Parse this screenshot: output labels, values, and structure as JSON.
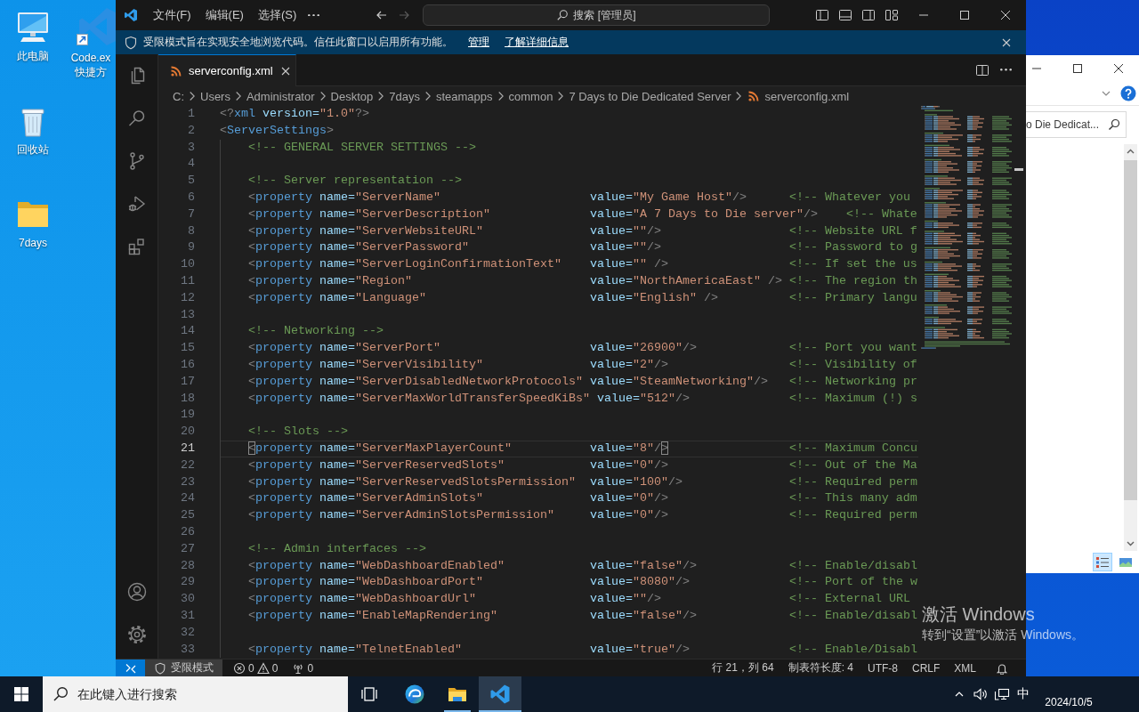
{
  "desktop": {
    "icons": [
      {
        "kind": "computer",
        "lines": [
          "此电脑"
        ]
      },
      {
        "kind": "recycle-bin",
        "lines": [
          "回收站"
        ]
      },
      {
        "kind": "folder",
        "lines": [
          "7days"
        ]
      },
      {
        "kind": "shortcut",
        "lines": [
          "Code.ex",
          "快捷方"
        ]
      }
    ]
  },
  "editor_window": {
    "menus": [
      "文件(F)",
      "编辑(E)",
      "选择(S)"
    ],
    "navigation": [
      {
        "kind": "back",
        "disabled": false
      },
      {
        "kind": "forward",
        "disabled": true
      }
    ],
    "command_center": "搜索 [管理员]",
    "banner": {
      "message": "受限模式旨在实现安全地浏览代码。信任此窗口以启用所有功能。",
      "links": [
        "管理",
        "了解详细信息"
      ]
    },
    "tabs": [
      {
        "label": "serverconfig.xml",
        "selected": true
      }
    ],
    "breadcrumbs": [
      {
        "kind": "folder",
        "label": "C:"
      },
      {
        "kind": "folder",
        "label": "Users"
      },
      {
        "kind": "folder",
        "label": "Administrator"
      },
      {
        "kind": "folder",
        "label": "Desktop"
      },
      {
        "kind": "folder",
        "label": "7days"
      },
      {
        "kind": "folder",
        "label": "steamapps"
      },
      {
        "kind": "folder",
        "label": "common"
      },
      {
        "kind": "folder",
        "label": "7 Days to Die Dedicated Server"
      },
      {
        "kind": "file",
        "label": "serverconfig.xml"
      }
    ],
    "lines": [
      {
        "number": "1",
        "current": false,
        "tokens": [
          {
            "kind": "punct",
            "text": "<?"
          },
          {
            "kind": "tag",
            "text": "xml"
          },
          {
            "kind": "attr",
            "text": " version="
          },
          {
            "kind": "string",
            "text": "\"1.0\""
          },
          {
            "kind": "punct",
            "text": "?>"
          }
        ]
      },
      {
        "number": "2",
        "current": false,
        "tokens": [
          {
            "kind": "punct",
            "text": "<"
          },
          {
            "kind": "tag",
            "text": "ServerSettings"
          },
          {
            "kind": "punct",
            "text": ">"
          }
        ],
        "children": [
          {
            "number": "3",
            "current": false,
            "tokens": [
              {
                "kind": "comment",
                "text": "<!-- GENERAL SERVER SETTINGS -->"
              }
            ]
          },
          {
            "number": "4",
            "current": false
          },
          {
            "number": "5",
            "current": false,
            "tokens": [
              {
                "kind": "comment",
                "text": "<!-- Server representation -->"
              }
            ]
          },
          {
            "number": "6",
            "current": false,
            "tokens": [
              {
                "kind": "punct",
                "text": "<"
              },
              {
                "kind": "tag",
                "text": "property"
              },
              {
                "kind": "attr",
                "text": " name="
              },
              {
                "kind": "string",
                "text": "\"ServerName\""
              },
              {
                "kind": "attr",
                "text": "                     value="
              },
              {
                "kind": "string",
                "text": "\"My Game Host\""
              },
              {
                "kind": "punct",
                "text": "/>      "
              },
              {
                "kind": "comment",
                "text": "<!-- Whatever you"
              }
            ]
          },
          {
            "number": "7",
            "current": false,
            "tokens": [
              {
                "kind": "punct",
                "text": "<"
              },
              {
                "kind": "tag",
                "text": "property"
              },
              {
                "kind": "attr",
                "text": " name="
              },
              {
                "kind": "string",
                "text": "\"ServerDescription\""
              },
              {
                "kind": "attr",
                "text": "              value="
              },
              {
                "kind": "string",
                "text": "\"A 7 Days to Die server\""
              },
              {
                "kind": "punct",
                "text": "/>    "
              },
              {
                "kind": "comment",
                "text": "<!-- Whate"
              }
            ]
          },
          {
            "number": "8",
            "current": false,
            "tokens": [
              {
                "kind": "punct",
                "text": "<"
              },
              {
                "kind": "tag",
                "text": "property"
              },
              {
                "kind": "attr",
                "text": " name="
              },
              {
                "kind": "string",
                "text": "\"ServerWebsiteURL\""
              },
              {
                "kind": "attr",
                "text": "               value="
              },
              {
                "kind": "string",
                "text": "\"\""
              },
              {
                "kind": "punct",
                "text": "/>                  "
              },
              {
                "kind": "comment",
                "text": "<!-- Website URL f"
              }
            ]
          },
          {
            "number": "9",
            "current": false,
            "tokens": [
              {
                "kind": "punct",
                "text": "<"
              },
              {
                "kind": "tag",
                "text": "property"
              },
              {
                "kind": "attr",
                "text": " name="
              },
              {
                "kind": "string",
                "text": "\"ServerPassword\""
              },
              {
                "kind": "attr",
                "text": "                 value="
              },
              {
                "kind": "string",
                "text": "\"\""
              },
              {
                "kind": "punct",
                "text": "/>                  "
              },
              {
                "kind": "comment",
                "text": "<!-- Password to g"
              }
            ]
          },
          {
            "number": "10",
            "current": false,
            "tokens": [
              {
                "kind": "punct",
                "text": "<"
              },
              {
                "kind": "tag",
                "text": "property"
              },
              {
                "kind": "attr",
                "text": " name="
              },
              {
                "kind": "string",
                "text": "\"ServerLoginConfirmationText\""
              },
              {
                "kind": "attr",
                "text": "    value="
              },
              {
                "kind": "string",
                "text": "\"\""
              },
              {
                "kind": "punct",
                "text": " />                 "
              },
              {
                "kind": "comment",
                "text": "<!-- If set the us"
              }
            ]
          },
          {
            "number": "11",
            "current": false,
            "tokens": [
              {
                "kind": "punct",
                "text": "<"
              },
              {
                "kind": "tag",
                "text": "property"
              },
              {
                "kind": "attr",
                "text": " name="
              },
              {
                "kind": "string",
                "text": "\"Region\""
              },
              {
                "kind": "attr",
                "text": "                         value="
              },
              {
                "kind": "string",
                "text": "\"NorthAmericaEast\""
              },
              {
                "kind": "punct",
                "text": " /> "
              },
              {
                "kind": "comment",
                "text": "<!-- The region th"
              }
            ]
          },
          {
            "number": "12",
            "current": false,
            "tokens": [
              {
                "kind": "punct",
                "text": "<"
              },
              {
                "kind": "tag",
                "text": "property"
              },
              {
                "kind": "attr",
                "text": " name="
              },
              {
                "kind": "string",
                "text": "\"Language\""
              },
              {
                "kind": "attr",
                "text": "                       value="
              },
              {
                "kind": "string",
                "text": "\"English\""
              },
              {
                "kind": "punct",
                "text": " />          "
              },
              {
                "kind": "comment",
                "text": "<!-- Primary langu"
              }
            ]
          },
          {
            "number": "13",
            "current": false
          },
          {
            "number": "14",
            "current": false,
            "tokens": [
              {
                "kind": "comment",
                "text": "<!-- Networking -->"
              }
            ]
          },
          {
            "number": "15",
            "current": false,
            "tokens": [
              {
                "kind": "punct",
                "text": "<"
              },
              {
                "kind": "tag",
                "text": "property"
              },
              {
                "kind": "attr",
                "text": " name="
              },
              {
                "kind": "string",
                "text": "\"ServerPort\""
              },
              {
                "kind": "attr",
                "text": "                     value="
              },
              {
                "kind": "string",
                "text": "\"26900\""
              },
              {
                "kind": "punct",
                "text": "/>             "
              },
              {
                "kind": "comment",
                "text": "<!-- Port you want"
              }
            ]
          },
          {
            "number": "16",
            "current": false,
            "tokens": [
              {
                "kind": "punct",
                "text": "<"
              },
              {
                "kind": "tag",
                "text": "property"
              },
              {
                "kind": "attr",
                "text": " name="
              },
              {
                "kind": "string",
                "text": "\"ServerVisibility\""
              },
              {
                "kind": "attr",
                "text": "               value="
              },
              {
                "kind": "string",
                "text": "\"2\""
              },
              {
                "kind": "punct",
                "text": "/>                 "
              },
              {
                "kind": "comment",
                "text": "<!-- Visibility of"
              }
            ]
          },
          {
            "number": "17",
            "current": false,
            "tokens": [
              {
                "kind": "punct",
                "text": "<"
              },
              {
                "kind": "tag",
                "text": "property"
              },
              {
                "kind": "attr",
                "text": " name="
              },
              {
                "kind": "string",
                "text": "\"ServerDisabledNetworkProtocols\""
              },
              {
                "kind": "attr",
                "text": " value="
              },
              {
                "kind": "string",
                "text": "\"SteamNetworking\""
              },
              {
                "kind": "punct",
                "text": "/>   "
              },
              {
                "kind": "comment",
                "text": "<!-- Networking pr"
              }
            ]
          },
          {
            "number": "18",
            "current": false,
            "tokens": [
              {
                "kind": "punct",
                "text": "<"
              },
              {
                "kind": "tag",
                "text": "property"
              },
              {
                "kind": "attr",
                "text": " name="
              },
              {
                "kind": "string",
                "text": "\"ServerMaxWorldTransferSpeedKiBs\""
              },
              {
                "kind": "attr",
                "text": " value="
              },
              {
                "kind": "string",
                "text": "\"512\""
              },
              {
                "kind": "punct",
                "text": "/>              "
              },
              {
                "kind": "comment",
                "text": "<!-- Maximum (!) s"
              }
            ]
          },
          {
            "number": "19",
            "current": false
          },
          {
            "number": "20",
            "current": false,
            "tokens": [
              {
                "kind": "comment",
                "text": "<!-- Slots -->"
              }
            ]
          },
          {
            "number": "21",
            "current": true,
            "tokens": [
              {
                "kind": "match",
                "text": "<"
              },
              {
                "kind": "tag",
                "text": "property"
              },
              {
                "kind": "attr",
                "text": " name="
              },
              {
                "kind": "string",
                "text": "\"ServerMaxPlayerCount\""
              },
              {
                "kind": "attr",
                "text": "           value="
              },
              {
                "kind": "string",
                "text": "\"8\""
              },
              {
                "kind": "punct",
                "text": "/"
              },
              {
                "kind": "match",
                "text": ">"
              },
              {
                "kind": "comment",
                "text": "                 <!-- Maximum Concu"
              }
            ]
          },
          {
            "number": "22",
            "current": false,
            "tokens": [
              {
                "kind": "punct",
                "text": "<"
              },
              {
                "kind": "tag",
                "text": "property"
              },
              {
                "kind": "attr",
                "text": " name="
              },
              {
                "kind": "string",
                "text": "\"ServerReservedSlots\""
              },
              {
                "kind": "attr",
                "text": "            value="
              },
              {
                "kind": "string",
                "text": "\"0\""
              },
              {
                "kind": "punct",
                "text": "/>                 "
              },
              {
                "kind": "comment",
                "text": "<!-- Out of the Ma"
              }
            ]
          },
          {
            "number": "23",
            "current": false,
            "tokens": [
              {
                "kind": "punct",
                "text": "<"
              },
              {
                "kind": "tag",
                "text": "property"
              },
              {
                "kind": "attr",
                "text": " name="
              },
              {
                "kind": "string",
                "text": "\"ServerReservedSlotsPermission\""
              },
              {
                "kind": "attr",
                "text": "  value="
              },
              {
                "kind": "string",
                "text": "\"100\""
              },
              {
                "kind": "punct",
                "text": "/>               "
              },
              {
                "kind": "comment",
                "text": "<!-- Required perm"
              }
            ]
          },
          {
            "number": "24",
            "current": false,
            "tokens": [
              {
                "kind": "punct",
                "text": "<"
              },
              {
                "kind": "tag",
                "text": "property"
              },
              {
                "kind": "attr",
                "text": " name="
              },
              {
                "kind": "string",
                "text": "\"ServerAdminSlots\""
              },
              {
                "kind": "attr",
                "text": "               value="
              },
              {
                "kind": "string",
                "text": "\"0\""
              },
              {
                "kind": "punct",
                "text": "/>                 "
              },
              {
                "kind": "comment",
                "text": "<!-- This many adm"
              }
            ]
          },
          {
            "number": "25",
            "current": false,
            "tokens": [
              {
                "kind": "punct",
                "text": "<"
              },
              {
                "kind": "tag",
                "text": "property"
              },
              {
                "kind": "attr",
                "text": " name="
              },
              {
                "kind": "string",
                "text": "\"ServerAdminSlotsPermission\""
              },
              {
                "kind": "attr",
                "text": "     value="
              },
              {
                "kind": "string",
                "text": "\"0\""
              },
              {
                "kind": "punct",
                "text": "/>                 "
              },
              {
                "kind": "comment",
                "text": "<!-- Required perm"
              }
            ]
          },
          {
            "number": "26",
            "current": false
          },
          {
            "number": "27",
            "current": false,
            "tokens": [
              {
                "kind": "comment",
                "text": "<!-- Admin interfaces -->"
              }
            ]
          },
          {
            "number": "28",
            "current": false,
            "tokens": [
              {
                "kind": "punct",
                "text": "<"
              },
              {
                "kind": "tag",
                "text": "property"
              },
              {
                "kind": "attr",
                "text": " name="
              },
              {
                "kind": "string",
                "text": "\"WebDashboardEnabled\""
              },
              {
                "kind": "attr",
                "text": "            value="
              },
              {
                "kind": "string",
                "text": "\"false\""
              },
              {
                "kind": "punct",
                "text": "/>             "
              },
              {
                "kind": "comment",
                "text": "<!-- Enable/disabl"
              }
            ]
          },
          {
            "number": "29",
            "current": false,
            "tokens": [
              {
                "kind": "punct",
                "text": "<"
              },
              {
                "kind": "tag",
                "text": "property"
              },
              {
                "kind": "attr",
                "text": " name="
              },
              {
                "kind": "string",
                "text": "\"WebDashboardPort\""
              },
              {
                "kind": "attr",
                "text": "               value="
              },
              {
                "kind": "string",
                "text": "\"8080\""
              },
              {
                "kind": "punct",
                "text": "/>              "
              },
              {
                "kind": "comment",
                "text": "<!-- Port of the w"
              }
            ]
          },
          {
            "number": "30",
            "current": false,
            "tokens": [
              {
                "kind": "punct",
                "text": "<"
              },
              {
                "kind": "tag",
                "text": "property"
              },
              {
                "kind": "attr",
                "text": " name="
              },
              {
                "kind": "string",
                "text": "\"WebDashboardUrl\""
              },
              {
                "kind": "attr",
                "text": "                value="
              },
              {
                "kind": "string",
                "text": "\"\""
              },
              {
                "kind": "punct",
                "text": "/>                  "
              },
              {
                "kind": "comment",
                "text": "<!-- External URL"
              }
            ]
          },
          {
            "number": "31",
            "current": false,
            "tokens": [
              {
                "kind": "punct",
                "text": "<"
              },
              {
                "kind": "tag",
                "text": "property"
              },
              {
                "kind": "attr",
                "text": " name="
              },
              {
                "kind": "string",
                "text": "\"EnableMapRendering\""
              },
              {
                "kind": "attr",
                "text": "             value="
              },
              {
                "kind": "string",
                "text": "\"false\""
              },
              {
                "kind": "punct",
                "text": "/>             "
              },
              {
                "kind": "comment",
                "text": "<!-- Enable/disabl"
              }
            ]
          },
          {
            "number": "32",
            "current": false
          },
          {
            "number": "33",
            "current": false,
            "tokens": [
              {
                "kind": "punct",
                "text": "<"
              },
              {
                "kind": "tag",
                "text": "property"
              },
              {
                "kind": "attr",
                "text": " name="
              },
              {
                "kind": "string",
                "text": "\"TelnetEnabled\""
              },
              {
                "kind": "attr",
                "text": "                  value="
              },
              {
                "kind": "string",
                "text": "\"true\""
              },
              {
                "kind": "punct",
                "text": "/>              "
              },
              {
                "kind": "comment",
                "text": "<!-- Enable/Disabl"
              }
            ]
          }
        ]
      }
    ],
    "status_bar": {
      "restricted_mode": "受限模式",
      "errors": "0",
      "warnings": "0",
      "ports": "0",
      "cursor_position": "行 21，列 64",
      "indentation": "制表符长度: 4",
      "encoding": "UTF-8",
      "line_ending": "CRLF",
      "language": "XML"
    }
  },
  "background_window": {
    "search": {
      "placeholder": "o Die Dedicat..."
    },
    "views": [
      {
        "kind": "details",
        "selected": true
      },
      {
        "kind": "large-icons",
        "selected": false
      }
    ]
  },
  "taskbar": {
    "search": {
      "placeholder": "在此键入进行搜索"
    },
    "apps": [
      {
        "kind": "edge",
        "running": false,
        "selected": false
      },
      {
        "kind": "explorer",
        "running": true,
        "selected": false
      },
      {
        "kind": "vscode",
        "running": true,
        "selected": true
      }
    ],
    "ime": "中",
    "date": "2024/10/5"
  },
  "activation_notice": {
    "title": "激活 Windows",
    "message": "转到“设置”以激活 Windows。"
  }
}
